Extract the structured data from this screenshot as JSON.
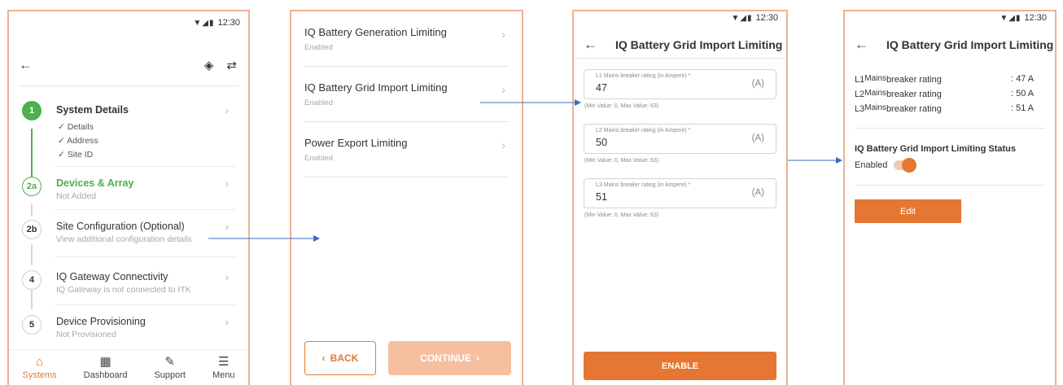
{
  "status_bar": {
    "time": "12:30"
  },
  "screen1": {
    "steps": [
      {
        "number": "1",
        "title": "System Details",
        "checks": [
          "Details",
          "Address",
          "Site ID"
        ]
      },
      {
        "number": "2a",
        "title": "Devices & Array",
        "subtitle": "Not Added"
      },
      {
        "number": "2b",
        "title": "Site Configuration (Optional)",
        "subtitle": "View additional configuration details"
      },
      {
        "number": "4",
        "title": "IQ Gateway Connectivity",
        "subtitle": "IQ Gateway is not connected to ITK"
      },
      {
        "number": "5",
        "title": "Device Provisioning",
        "subtitle": "Not Provisioned"
      }
    ],
    "nav": [
      {
        "label": "Systems",
        "icon": "home-icon"
      },
      {
        "label": "Dashboard",
        "icon": "dashboard-icon"
      },
      {
        "label": "Support",
        "icon": "wrench-icon"
      },
      {
        "label": "Menu",
        "icon": "menu-icon"
      }
    ]
  },
  "screen2": {
    "items": [
      {
        "title": "IQ Battery Generation Limiting",
        "subtitle": "Enabled"
      },
      {
        "title": "IQ Battery Grid Import Limiting",
        "subtitle": "Enabled"
      },
      {
        "title": "Power Export Limiting",
        "subtitle": "Enabled"
      }
    ],
    "back_label": "BACK",
    "continue_label": "CONTINUE"
  },
  "screen3": {
    "title": "IQ Battery Grid Import Limiting",
    "fields": [
      {
        "label": "L1 Mains breaker rating (in Ampere) *",
        "value": "47",
        "unit": "(A)",
        "hint": "(Min Value: 0, Max Value: 63)"
      },
      {
        "label": "L2 Mains breaker rating (in Ampere) *",
        "value": "50",
        "unit": "(A)",
        "hint": "(Min Value: 0, Max Value: 63)"
      },
      {
        "label": "L3 Mains breaker rating (in Ampere) *",
        "value": "51",
        "unit": "(A)",
        "hint": "(Min Value: 0, Max Value: 63)"
      }
    ],
    "enable_label": "ENABLE"
  },
  "screen4": {
    "title": "IQ Battery Grid Import Limiting",
    "ratings": [
      {
        "phase": "L1",
        "mains": "Mains",
        "label": "breaker rating",
        "value": ": 47 A"
      },
      {
        "phase": "L2",
        "mains": "Mains",
        "label": "breaker rating",
        "value": ": 50 A"
      },
      {
        "phase": "L3",
        "mains": "Mains",
        "label": "breaker rating",
        "value": ": 51 A"
      }
    ],
    "status_title": "IQ Battery Grid Import Limiting Status",
    "status_value": "Enabled",
    "toggle_on": true,
    "edit_label": "Edit"
  },
  "colors": {
    "accent": "#e57733",
    "success": "#4caf50",
    "link_arrow": "#3c6bc0"
  }
}
